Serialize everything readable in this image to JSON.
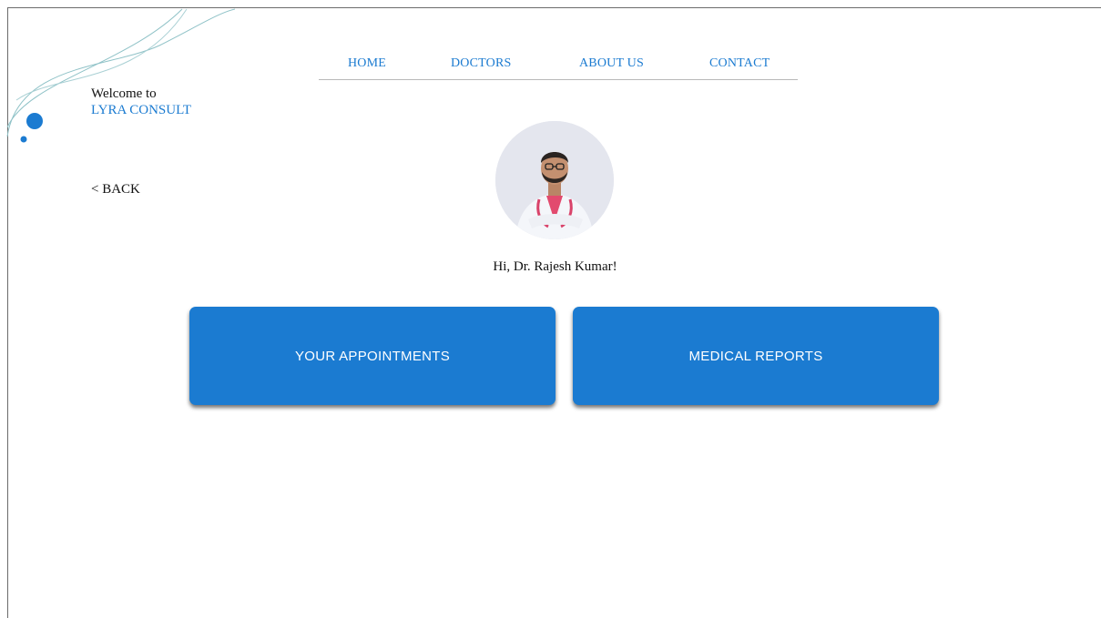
{
  "brand": {
    "welcome": "Welcome to",
    "name": "LYRA CONSULT"
  },
  "nav": {
    "items": [
      {
        "label": "HOME"
      },
      {
        "label": "DOCTORS"
      },
      {
        "label": "ABOUT US"
      },
      {
        "label": "CONTACT"
      }
    ]
  },
  "back": {
    "label": "< BACK"
  },
  "profile": {
    "greeting": "Hi, Dr. Rajesh Kumar!"
  },
  "cards": {
    "appointments": "YOUR APPOINTMENTS",
    "reports": "MEDICAL REPORTS"
  },
  "colors": {
    "accent": "#1b7bd1",
    "text": "#111111",
    "background": "#ffffff"
  }
}
